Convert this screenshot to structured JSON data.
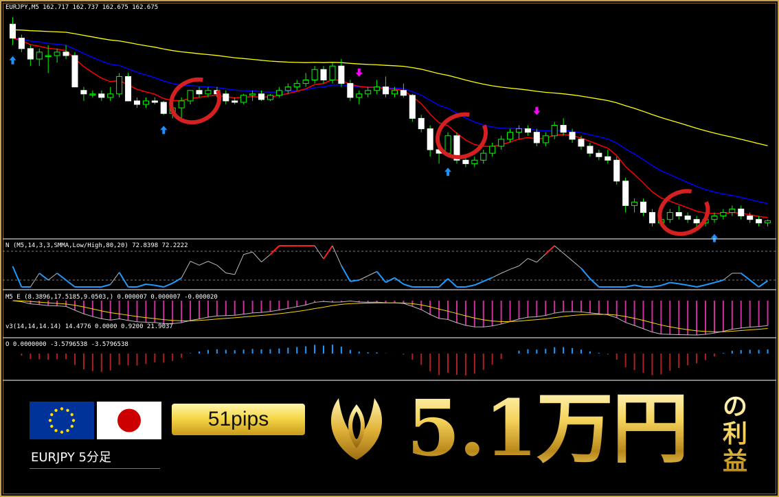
{
  "header": {
    "symbol_line": "EURJPY,M5  162.717 162.737 162.675 162.675",
    "ind1_line": "N (M5,14,3,3,SMMA,Low/High,80,20) 72.8398 72.2222",
    "ind2_line": "M5 E (8.3896,17.5185,9.0503,) 0.000007 0.000007 -0.000020",
    "ind2b_line": "v3(14,14,14.14) 14.4776 0.0000 0.9200 21.9037",
    "ind3_line": "O 0.0000000 -3.5796538 -3.5796538"
  },
  "colors": {
    "bull": "#00ff00",
    "bear": "#ffffff",
    "ma_slow": "#ffff00",
    "ma_mid": "#0000ff",
    "ma_fast": "#ff0000",
    "arrow_up": "#1e90ff",
    "arrow_down": "#ff00ff",
    "stoch_low": "#1e9bff",
    "stoch_high": "#ff2020",
    "hist_pos": "#d02fa0",
    "osma_neg": "#b02020",
    "osma_pos": "#1e9bff",
    "frame": "#c9a44a",
    "circle": "#d42020"
  },
  "footer": {
    "pair_label": "EURJPY 5分足",
    "pips_label": "51pips",
    "profit_label": "5.1万円",
    "suffix_line1": "の",
    "suffix_line2": "利",
    "suffix_line3": "益"
  },
  "flags": {
    "eu_icon": "eu-flag-icon",
    "jp_icon": "japan-flag-icon"
  },
  "chart_data": {
    "type": "candlestick",
    "symbol": "EURJPY",
    "timeframe": "M5",
    "ohlc_header": [
      162.717,
      162.737,
      162.675,
      162.675
    ],
    "candles": [
      [
        162.9,
        163.0,
        162.6,
        162.7
      ],
      [
        162.7,
        162.75,
        162.5,
        162.55
      ],
      [
        162.55,
        162.6,
        162.3,
        162.4
      ],
      [
        162.4,
        162.55,
        162.3,
        162.5
      ],
      [
        162.45,
        162.6,
        162.2,
        162.45
      ],
      [
        162.45,
        162.55,
        162.35,
        162.5
      ],
      [
        162.5,
        162.6,
        162.4,
        162.45
      ],
      [
        162.45,
        162.5,
        162.0,
        162.0
      ],
      [
        161.95,
        162.0,
        161.8,
        161.9
      ],
      [
        161.9,
        161.95,
        161.85,
        161.9
      ],
      [
        161.9,
        161.95,
        161.8,
        161.85
      ],
      [
        161.85,
        162.0,
        161.8,
        161.9
      ],
      [
        161.9,
        162.2,
        161.85,
        162.15
      ],
      [
        162.15,
        162.2,
        161.8,
        161.8
      ],
      [
        161.8,
        161.85,
        161.7,
        161.75
      ],
      [
        161.75,
        161.85,
        161.7,
        161.8
      ],
      [
        161.8,
        161.85,
        161.75,
        161.78
      ],
      [
        161.78,
        161.8,
        161.6,
        161.62
      ],
      [
        161.62,
        161.75,
        161.55,
        161.7
      ],
      [
        161.7,
        161.85,
        161.55,
        161.8
      ],
      [
        161.8,
        161.95,
        161.75,
        161.95
      ],
      [
        161.95,
        162.0,
        161.85,
        161.9
      ],
      [
        161.9,
        162.0,
        161.85,
        161.95
      ],
      [
        161.95,
        162.0,
        161.85,
        161.9
      ],
      [
        161.9,
        161.95,
        161.75,
        161.8
      ],
      [
        161.8,
        161.85,
        161.75,
        161.78
      ],
      [
        161.78,
        161.9,
        161.75,
        161.88
      ],
      [
        161.88,
        161.95,
        161.8,
        161.9
      ],
      [
        161.9,
        161.95,
        161.8,
        161.82
      ],
      [
        161.82,
        161.9,
        161.8,
        161.88
      ],
      [
        161.88,
        162.0,
        161.85,
        161.95
      ],
      [
        161.95,
        162.05,
        161.9,
        162.0
      ],
      [
        162.0,
        162.1,
        161.95,
        162.05
      ],
      [
        162.05,
        162.2,
        162.0,
        162.1
      ],
      [
        162.1,
        162.3,
        162.05,
        162.25
      ],
      [
        162.25,
        162.3,
        162.05,
        162.1
      ],
      [
        162.1,
        162.35,
        162.05,
        162.3
      ],
      [
        162.3,
        162.4,
        162.0,
        162.05
      ],
      [
        162.05,
        162.1,
        161.8,
        161.85
      ],
      [
        161.85,
        161.95,
        161.75,
        161.9
      ],
      [
        161.9,
        162.0,
        161.85,
        161.95
      ],
      [
        161.95,
        162.1,
        161.9,
        162.0
      ],
      [
        162.0,
        162.15,
        161.85,
        161.9
      ],
      [
        161.9,
        162.0,
        161.85,
        161.95
      ],
      [
        161.95,
        162.05,
        161.85,
        161.88
      ],
      [
        161.88,
        161.9,
        161.5,
        161.55
      ],
      [
        161.55,
        161.6,
        161.35,
        161.4
      ],
      [
        161.4,
        161.45,
        161.0,
        161.1
      ],
      [
        161.1,
        161.2,
        160.9,
        161.05
      ],
      [
        161.05,
        161.35,
        161.0,
        161.3
      ],
      [
        161.3,
        161.35,
        160.9,
        160.95
      ],
      [
        160.95,
        161.0,
        160.85,
        160.9
      ],
      [
        160.9,
        161.0,
        160.85,
        160.95
      ],
      [
        160.95,
        161.1,
        160.9,
        161.05
      ],
      [
        161.05,
        161.2,
        161.0,
        161.15
      ],
      [
        161.15,
        161.3,
        161.1,
        161.25
      ],
      [
        161.25,
        161.4,
        161.2,
        161.35
      ],
      [
        161.35,
        161.45,
        161.25,
        161.4
      ],
      [
        161.4,
        161.45,
        161.3,
        161.35
      ],
      [
        161.35,
        161.4,
        161.15,
        161.2
      ],
      [
        161.2,
        161.35,
        161.15,
        161.3
      ],
      [
        161.3,
        161.5,
        161.25,
        161.45
      ],
      [
        161.45,
        161.55,
        161.3,
        161.35
      ],
      [
        161.35,
        161.4,
        161.2,
        161.25
      ],
      [
        161.25,
        161.3,
        161.1,
        161.15
      ],
      [
        161.15,
        161.2,
        161.0,
        161.05
      ],
      [
        161.05,
        161.1,
        160.95,
        161.0
      ],
      [
        161.0,
        161.1,
        160.9,
        160.95
      ],
      [
        160.95,
        161.0,
        160.6,
        160.65
      ],
      [
        160.65,
        160.7,
        160.2,
        160.3
      ],
      [
        160.3,
        160.4,
        160.2,
        160.35
      ],
      [
        160.35,
        160.4,
        160.15,
        160.2
      ],
      [
        160.2,
        160.25,
        160.0,
        160.05
      ],
      [
        160.05,
        160.15,
        160.0,
        160.1
      ],
      [
        160.1,
        160.25,
        160.05,
        160.2
      ],
      [
        160.2,
        160.3,
        160.1,
        160.15
      ],
      [
        160.15,
        160.2,
        160.05,
        160.1
      ],
      [
        160.1,
        160.15,
        160.0,
        160.05
      ],
      [
        160.05,
        160.15,
        160.0,
        160.1
      ],
      [
        160.1,
        160.2,
        160.05,
        160.15
      ],
      [
        160.15,
        160.25,
        160.1,
        160.2
      ],
      [
        160.2,
        160.3,
        160.15,
        160.25
      ],
      [
        160.25,
        160.3,
        160.1,
        160.15
      ],
      [
        160.15,
        160.2,
        160.05,
        160.1
      ],
      [
        160.1,
        160.15,
        160.0,
        160.05
      ],
      [
        160.05,
        160.1,
        160.0,
        160.08
      ]
    ],
    "price_range": [
      159.9,
      163.05
    ],
    "up_arrow_indices": [
      0,
      17,
      49,
      79
    ],
    "down_arrow_indices": [
      39,
      59
    ],
    "highlight_indices": [
      19,
      49,
      74
    ],
    "grid": false
  }
}
